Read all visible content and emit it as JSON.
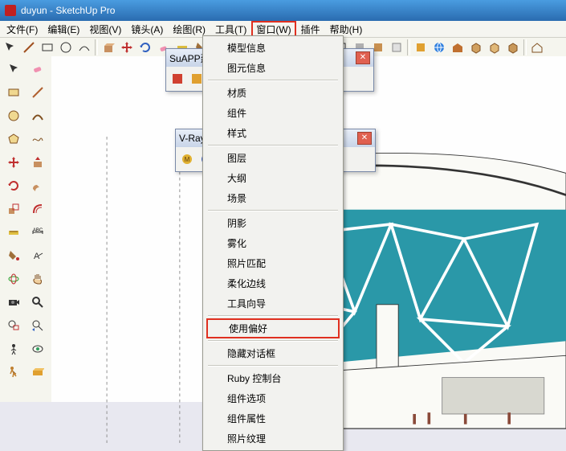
{
  "title": "duyun - SketchUp Pro",
  "menu": {
    "file": "文件(F)",
    "edit": "编辑(E)",
    "view": "视图(V)",
    "camera": "镜头(A)",
    "draw": "绘图(R)",
    "tools": "工具(T)",
    "window": "窗口(W)",
    "plugins": "插件",
    "help": "帮助(H)"
  },
  "dropdown": {
    "model_info": "模型信息",
    "entity_info": "图元信息",
    "materials": "材质",
    "components": "组件",
    "styles": "样式",
    "layers": "图层",
    "outliner": "大纲",
    "scenes": "场景",
    "shadows": "阴影",
    "fog": "雾化",
    "match_photo": "照片匹配",
    "soften": "柔化边线",
    "instructor": "工具向导",
    "preferences": "使用偏好",
    "hide_dialogs": "隐藏对话框",
    "ruby": "Ruby 控制台",
    "comp_opts": "组件选项",
    "comp_attrs": "组件属性",
    "photo_tex": "照片纹理"
  },
  "floats": {
    "suapp": "SuAPP建",
    "vray": "V-Ray"
  },
  "colors": {
    "menu_hi": "#e03020"
  }
}
